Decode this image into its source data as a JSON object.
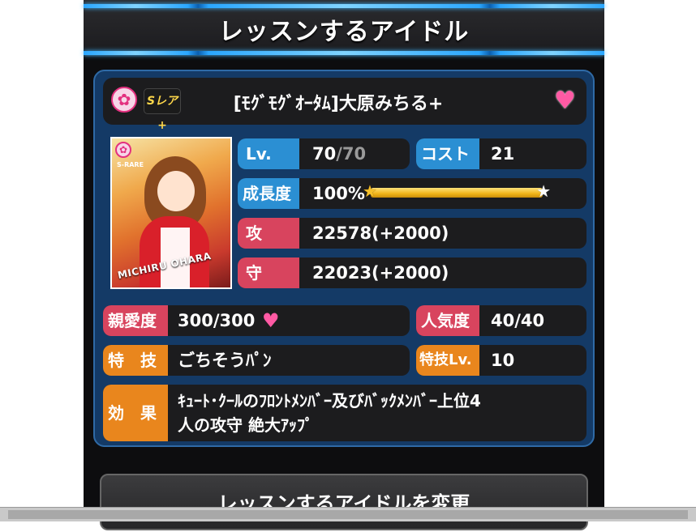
{
  "header": {
    "title": "レッスンするアイドル"
  },
  "card": {
    "attribute_icon": "cute-flower-icon",
    "rarity": "Sレア+",
    "name": "[ﾓｸﾞﾓｸﾞｵｰﾀﾑ]大原みちる+",
    "favorite_icon": "heart",
    "portrait": {
      "rank_text": "S-RARE",
      "name_text": "MICHIRU OHARA"
    }
  },
  "stats": {
    "level": {
      "label": "Lv.",
      "current": "70",
      "max": "/70"
    },
    "cost": {
      "label": "コスト",
      "value": "21"
    },
    "growth": {
      "label": "成長度",
      "value": "100%",
      "fill": 1.0
    },
    "attack": {
      "label": "攻",
      "value": "22578(+2000)"
    },
    "defense": {
      "label": "守",
      "value": "22023(+2000)"
    },
    "affection": {
      "label": "親愛度",
      "value": "300/300"
    },
    "popularity": {
      "label": "人気度",
      "value": "40/40"
    },
    "skill": {
      "label": "特　技",
      "value": "ごちそうﾊﾟﾝ"
    },
    "skill_level": {
      "label": "特技Lv.",
      "value": "10"
    },
    "effect": {
      "label": "効　果",
      "line1": "ｷｭｰﾄ･ｸｰﾙのﾌﾛﾝﾄﾒﾝﾊﾞｰ及びﾊﾞｯｸﾒﾝﾊﾞｰ上位4",
      "line2": "人の攻守 絶大ｱｯﾌﾟ"
    }
  },
  "actions": {
    "change_label": "レッスンするアイドルを変更"
  },
  "colors": {
    "panel": "#143a66",
    "label_blue": "#2b8fd3",
    "label_red": "#d8445e",
    "label_orange": "#e9861d",
    "heart": "#ff5aa4"
  }
}
